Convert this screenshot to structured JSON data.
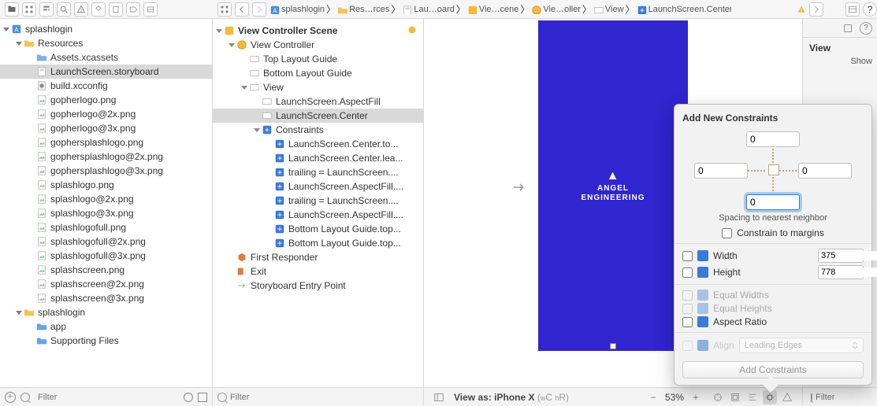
{
  "toolbar": {},
  "breadcrumb": [
    {
      "icon": "proj",
      "label": "splashlogin"
    },
    {
      "icon": "folder",
      "label": "Res…rces"
    },
    {
      "icon": "storyboard",
      "label": "Lau…oard"
    },
    {
      "icon": "scene",
      "label": "Vie…cene"
    },
    {
      "icon": "controller",
      "label": "Vie…oller"
    },
    {
      "icon": "view",
      "label": "View"
    },
    {
      "icon": "constraint",
      "label": "LaunchScreen.Center"
    }
  ],
  "navigator": {
    "filter_placeholder": "Filter",
    "tree": [
      {
        "d": 0,
        "icon": "proj",
        "label": "splashlogin",
        "open": true
      },
      {
        "d": 1,
        "icon": "yfolder",
        "label": "Resources",
        "open": true
      },
      {
        "d": 2,
        "icon": "assets",
        "label": "Assets.xcassets"
      },
      {
        "d": 2,
        "icon": "storyboard",
        "label": "LaunchScreen.storyboard",
        "sel": true
      },
      {
        "d": 2,
        "icon": "plist",
        "label": "build.xcconfig"
      },
      {
        "d": 2,
        "icon": "png",
        "label": "gopherlogo.png"
      },
      {
        "d": 2,
        "icon": "png",
        "label": "gopherlogo@2x.png"
      },
      {
        "d": 2,
        "icon": "png",
        "label": "gopherlogo@3x.png"
      },
      {
        "d": 2,
        "icon": "png",
        "label": "gophersplashlogo.png"
      },
      {
        "d": 2,
        "icon": "png",
        "label": "gophersplashlogo@2x.png"
      },
      {
        "d": 2,
        "icon": "png",
        "label": "gophersplashlogo@3x.png"
      },
      {
        "d": 2,
        "icon": "png",
        "label": "splashlogo.png"
      },
      {
        "d": 2,
        "icon": "png",
        "label": "splashlogo@2x.png"
      },
      {
        "d": 2,
        "icon": "png",
        "label": "splashlogo@3x.png"
      },
      {
        "d": 2,
        "icon": "png",
        "label": "splashlogofull.png"
      },
      {
        "d": 2,
        "icon": "png",
        "label": "splashlogofull@2x.png"
      },
      {
        "d": 2,
        "icon": "png",
        "label": "splashlogofull@3x.png"
      },
      {
        "d": 2,
        "icon": "png",
        "label": "splashscreen.png"
      },
      {
        "d": 2,
        "icon": "png",
        "label": "splashscreen@2x.png"
      },
      {
        "d": 2,
        "icon": "png",
        "label": "splashscreen@3x.png"
      },
      {
        "d": 1,
        "icon": "yfolder",
        "label": "splashlogin",
        "open": true
      },
      {
        "d": 2,
        "icon": "bfolder",
        "label": "app"
      },
      {
        "d": 2,
        "icon": "bfolder",
        "label": "Supporting Files"
      }
    ]
  },
  "outline": {
    "filter_placeholder": "Filter",
    "tree": [
      {
        "d": 0,
        "icon": "scene",
        "label": "View Controller Scene",
        "open": true,
        "hdr": true,
        "star": true
      },
      {
        "d": 1,
        "icon": "controller",
        "label": "View Controller",
        "open": true
      },
      {
        "d": 2,
        "icon": "hguide",
        "label": "Top Layout Guide"
      },
      {
        "d": 2,
        "icon": "hguide",
        "label": "Bottom Layout Guide"
      },
      {
        "d": 2,
        "icon": "view",
        "label": "View",
        "open": true
      },
      {
        "d": 3,
        "icon": "view",
        "label": "LaunchScreen.AspectFill"
      },
      {
        "d": 3,
        "icon": "view",
        "label": "LaunchScreen.Center",
        "sel": true
      },
      {
        "d": 3,
        "icon": "cgroup",
        "label": "Constraints",
        "open": true
      },
      {
        "d": 4,
        "icon": "c",
        "label": "LaunchScreen.Center.to..."
      },
      {
        "d": 4,
        "icon": "c",
        "label": "LaunchScreen.Center.lea..."
      },
      {
        "d": 4,
        "icon": "c",
        "label": "trailing = LaunchScreen...."
      },
      {
        "d": 4,
        "icon": "c",
        "label": "LaunchScreen.AspectFill...."
      },
      {
        "d": 4,
        "icon": "c",
        "label": "trailing = LaunchScreen...."
      },
      {
        "d": 4,
        "icon": "c",
        "label": "LaunchScreen.AspectFill...."
      },
      {
        "d": 4,
        "icon": "c",
        "label": "Bottom Layout Guide.top..."
      },
      {
        "d": 4,
        "icon": "c",
        "label": "Bottom Layout Guide.top..."
      },
      {
        "d": 1,
        "icon": "cube",
        "label": "First Responder"
      },
      {
        "d": 1,
        "icon": "exit",
        "label": "Exit"
      },
      {
        "d": 1,
        "icon": "arrow",
        "label": "Storyboard Entry Point"
      }
    ]
  },
  "canvas": {
    "brand_top": "ANGEL",
    "brand_bottom": "ENGINEERING",
    "view_as_label": "View as:",
    "device": "iPhone X",
    "size_class": "(wC hR)",
    "zoom": "53%"
  },
  "inspector": {
    "title": "View",
    "show_label": "Show",
    "filter_placeholder": "Filter"
  },
  "popover": {
    "title": "Add New Constraints",
    "top": "0",
    "left": "0",
    "right": "0",
    "bottom": "0",
    "spacing_caption": "Spacing to nearest neighbor",
    "constrain_margins": "Constrain to margins",
    "width_label": "Width",
    "width_val": "375",
    "height_label": "Height",
    "height_val": "778",
    "equal_widths": "Equal Widths",
    "equal_heights": "Equal Heights",
    "aspect_ratio": "Aspect Ratio",
    "align_label": "Align",
    "align_value": "Leading Edges",
    "add_button": "Add Constraints"
  }
}
